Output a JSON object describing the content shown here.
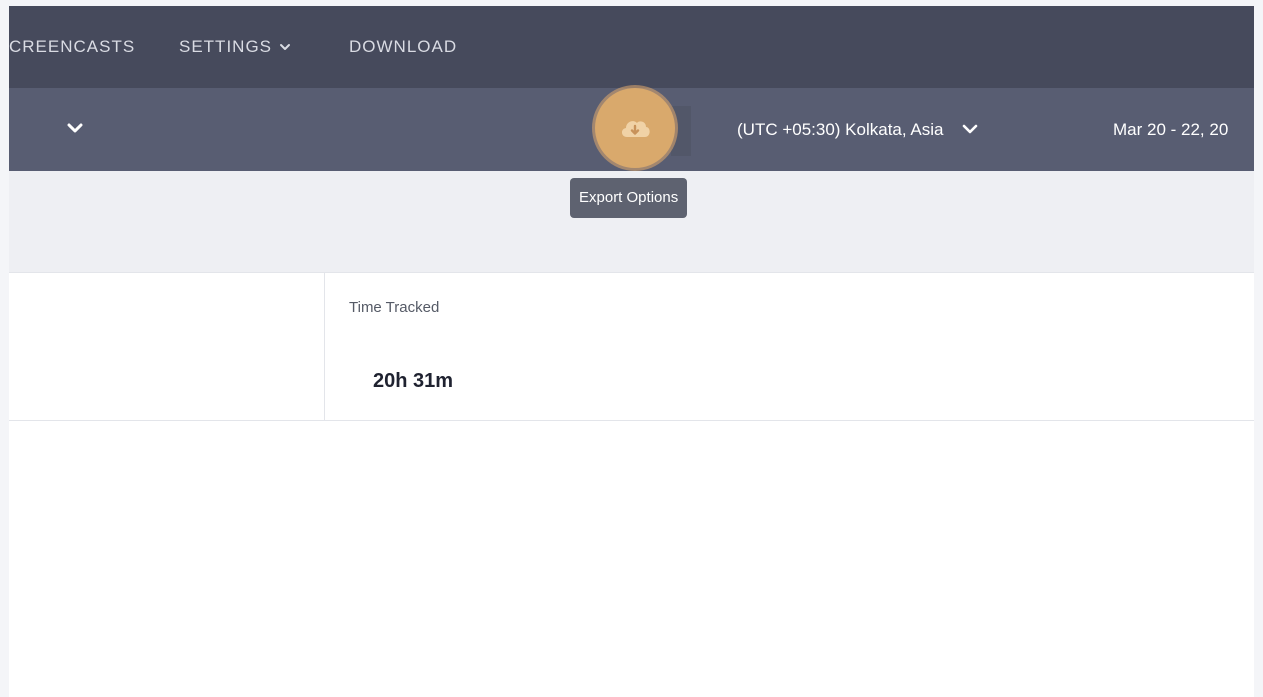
{
  "topnav": {
    "items": [
      {
        "label": "CREENCASTS"
      },
      {
        "label": "SETTINGS"
      },
      {
        "label": "DOWNLOAD"
      }
    ]
  },
  "subbar": {
    "timezone": "(UTC +05:30) Kolkata, Asia",
    "date_range": "Mar 20 - 22, 20"
  },
  "tooltip": {
    "text": "Export Options"
  },
  "table": {
    "column_header": "Time Tracked",
    "rows": [
      {
        "time_tracked": "20h 31m"
      }
    ]
  },
  "colors": {
    "nav_bg": "#464a5c",
    "subbar_bg": "#585d72",
    "export_accent": "#d9a96c"
  },
  "icons": {
    "export": "cloud-download-icon",
    "dropdown": "chevron-down-icon"
  }
}
